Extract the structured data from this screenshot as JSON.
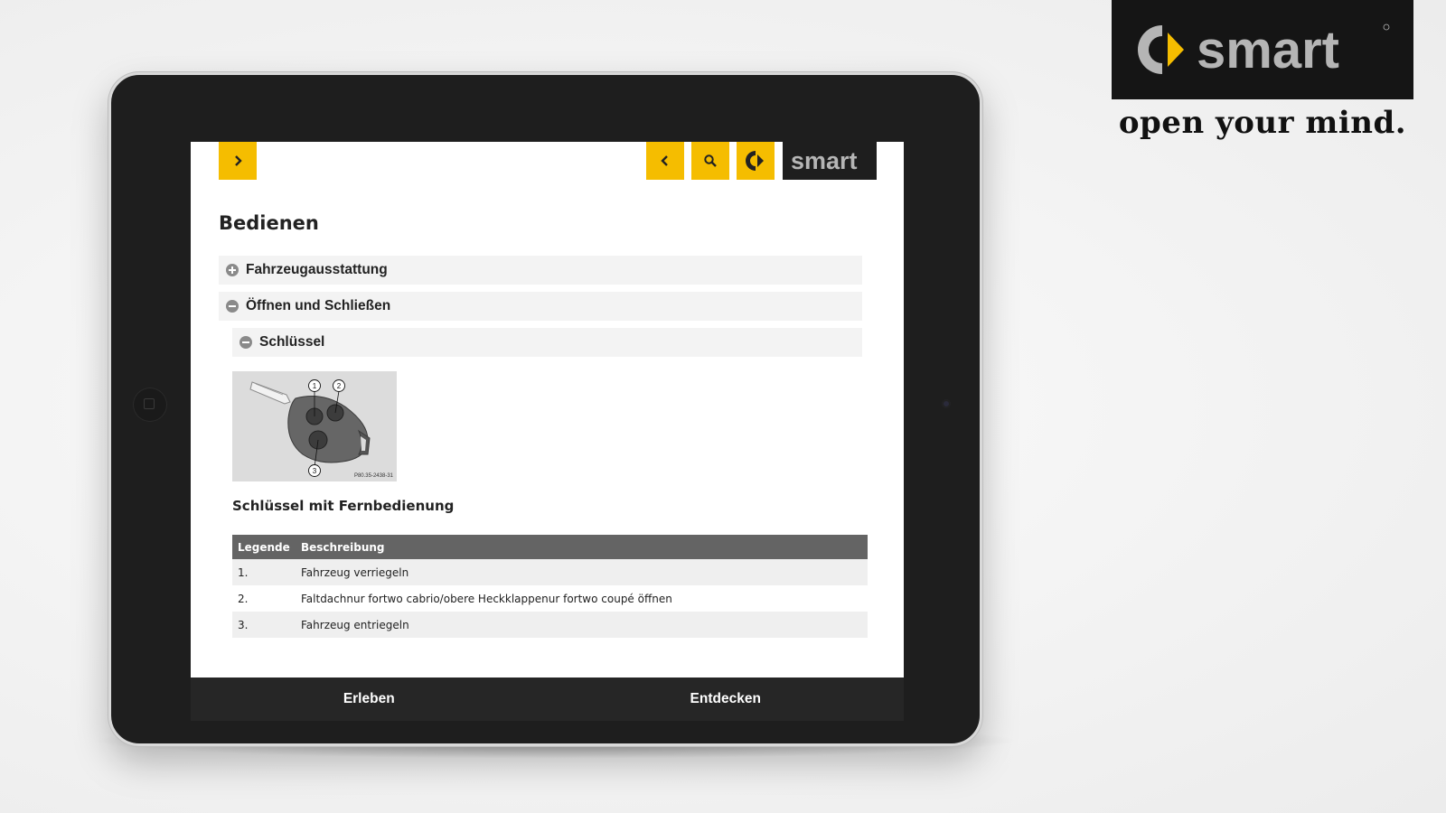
{
  "brand": {
    "logo_text": "smart",
    "tagline": "open your mind.",
    "accent_color": "#f5bd00",
    "dark_color": "#1e1e1e"
  },
  "toolbar": {
    "expand_icon": "chevron-right-icon",
    "back_icon": "chevron-left-icon",
    "search_icon": "search-icon",
    "home_icon": "smart-emblem-icon",
    "logo_text": "smart"
  },
  "page": {
    "title": "Bedienen"
  },
  "accordion": {
    "items": [
      {
        "label": "Fahrzeugausstattung",
        "state": "collapsed"
      },
      {
        "label": "Öffnen und Schließen",
        "state": "expanded"
      }
    ],
    "sub_item": {
      "label": "Schlüssel",
      "state": "expanded"
    }
  },
  "figure": {
    "callouts": [
      "1",
      "2",
      "3"
    ],
    "code": "P80.35-2438-31"
  },
  "section": {
    "heading": "Schlüssel mit Fernbedienung"
  },
  "table": {
    "headers": [
      "Legende",
      "Beschreibung"
    ],
    "rows": [
      [
        "1.",
        "Fahrzeug verriegeln"
      ],
      [
        "2.",
        "Faltdachnur fortwo cabrio/obere Heckklappenur fortwo coupé öffnen"
      ],
      [
        "3.",
        "Fahrzeug entriegeln"
      ]
    ]
  },
  "bottom_nav": {
    "items": [
      "Erleben",
      "Entdecken"
    ]
  }
}
